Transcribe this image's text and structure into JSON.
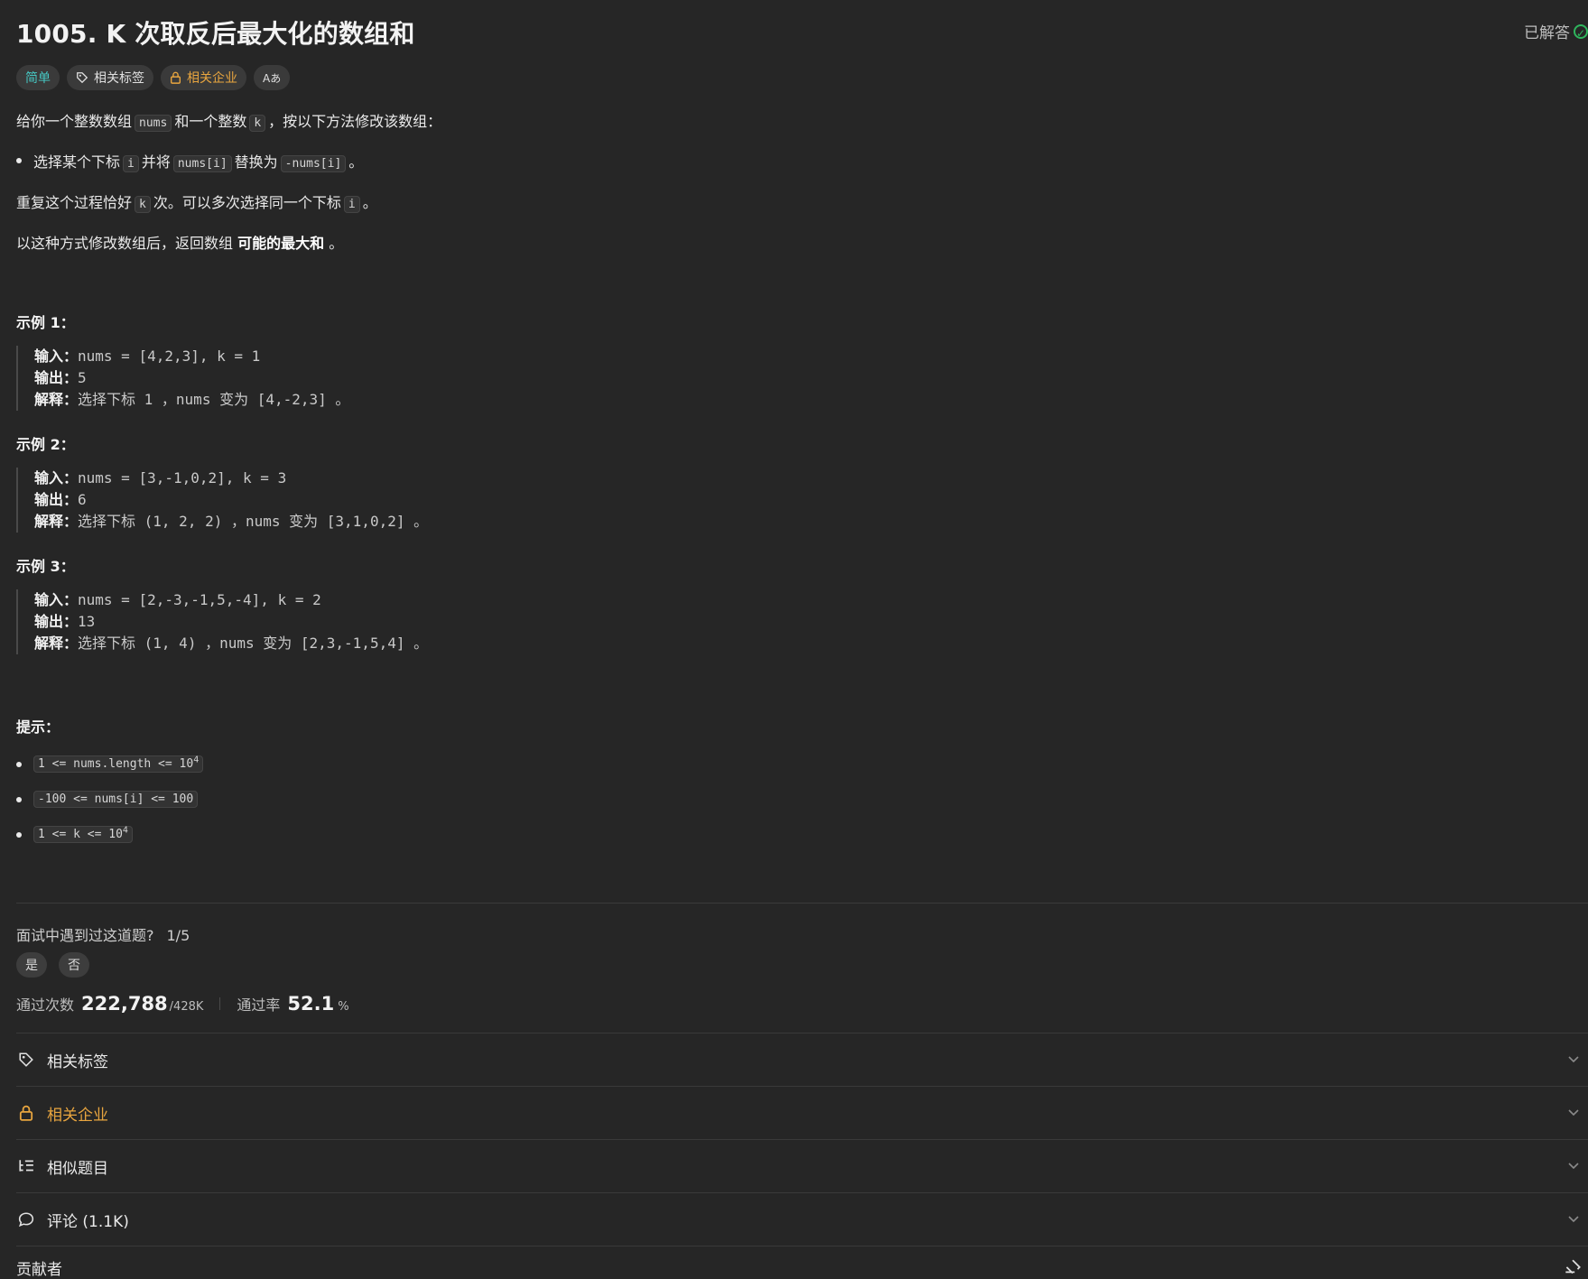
{
  "header": {
    "title": "1005. K 次取反后最大化的数组和",
    "status": "已解答"
  },
  "chips": {
    "difficulty": "简单",
    "tags": "相关标签",
    "companies": "相关企业",
    "translate": "Aあ"
  },
  "description": {
    "intro_a": "给你一个整数数组",
    "nums": "nums",
    "intro_b": "和一个整数",
    "k": "k",
    "intro_c": "，按以下方法修改该数组：",
    "b1_a": "选择某个下标",
    "i": "i",
    "b1_b": "并将",
    "numsi": "nums[i]",
    "b1_c": "替换为",
    "negnumsi": "-nums[i]",
    "b1_d": "。",
    "rep_a": "重复这个过程恰好",
    "rep_b": "次。可以多次选择同一个下标",
    "rep_c": "。",
    "ret_a": "以这种方式修改数组后，返回数组",
    "ret_b": "可能的最大和",
    "ret_c": "。"
  },
  "labels": {
    "input": "输入：",
    "output": "输出：",
    "explain": "解释："
  },
  "examples": [
    {
      "title": "示例 1：",
      "input": "nums = [4,2,3], k = 1",
      "output": "5",
      "explain": "选择下标 1 ，nums 变为 [4,-2,3] 。"
    },
    {
      "title": "示例 2：",
      "input": "nums = [3,-1,0,2], k = 3",
      "output": "6",
      "explain": "选择下标 (1, 2, 2) ，nums 变为 [3,1,0,2] 。"
    },
    {
      "title": "示例 3：",
      "input": "nums = [2,-3,-1,5,-4], k = 2",
      "output": "13",
      "explain": "选择下标 (1, 4) ，nums 变为 [2,3,-1,5,4] 。"
    }
  ],
  "hints": {
    "title": "提示：",
    "c1": "1 <= nums.length <= 10",
    "c1_sup": "4",
    "c2": "-100 <= nums[i] <= 100",
    "c3": "1 <= k <= 10",
    "c3_sup": "4"
  },
  "interview": {
    "question": "面试中遇到过这道题?",
    "count": "1/5",
    "yes": "是",
    "no": "否"
  },
  "stats": {
    "accepted_label": "通过次数",
    "accepted": "222,788",
    "total": "/428K",
    "rate_label": "通过率",
    "rate": "52.1",
    "rate_unit": "%"
  },
  "sections": {
    "tags": "相关标签",
    "companies": "相关企业",
    "similar": "相似题目",
    "comments": "评论 (1.1K)",
    "contributors": "贡献者"
  },
  "colors": {
    "easy": "#46c6c2",
    "company": "#e8a53f",
    "solved": "#2fb55d"
  }
}
